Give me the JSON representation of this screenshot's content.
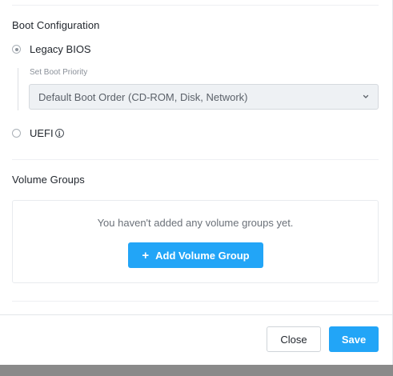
{
  "boot_configuration": {
    "title": "Boot Configuration",
    "legacy_bios_label": "Legacy BIOS",
    "legacy_bios_selected": true,
    "set_boot_priority_label": "Set Boot Priority",
    "boot_priority_value": "Default Boot Order (CD-ROM, Disk, Network)",
    "uefi_label": "UEFI",
    "uefi_selected": false,
    "info_icon": "info-icon"
  },
  "volume_groups": {
    "title": "Volume Groups",
    "empty_message": "You haven't added any volume groups yet.",
    "add_button_label": "Add Volume Group",
    "add_icon": "plus-icon"
  },
  "footer": {
    "close_label": "Close",
    "save_label": "Save"
  },
  "colors": {
    "primary": "#22a5f7",
    "text": "#22272e",
    "muted": "#8a9099",
    "select_bg": "#eef1f4"
  }
}
